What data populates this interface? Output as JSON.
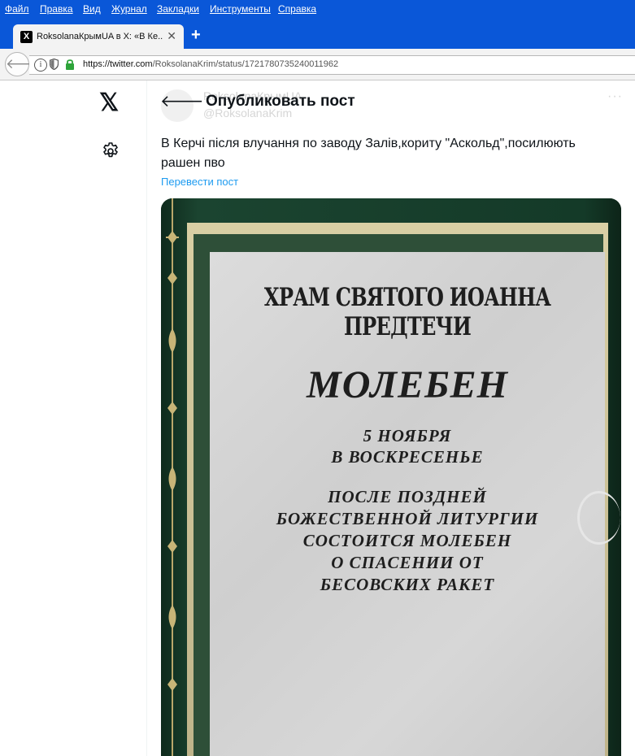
{
  "browser": {
    "menu": [
      "Файл",
      "Правка",
      "Вид",
      "Журнал",
      "Закладки",
      "Инструменты",
      "Справка"
    ],
    "tab_title": "RoksolanaКрымUA в X: «В Ке...",
    "url_prefix": "https://twitter.com",
    "url_rest": "/RoksolanaKrim/status/1721780735240011962"
  },
  "header": {
    "title": "Опубликовать пост",
    "ghost_name": "RoksolanaКрымUA",
    "ghost_handle": "@RoksolanaKrim"
  },
  "post": {
    "text": "В Керчі після влучання по заводу Залів,кориту \"Аскольд\",посилюють рашен пво",
    "translate": "Перевести пост"
  },
  "photo_sign": {
    "line1": "ХРАМ СВЯТОГО ИОАННА ПРЕДТЕЧИ",
    "line2": "МОЛЕБЕН",
    "line3": "5 НОЯБРЯ",
    "line4": "В ВОСКРЕСЕНЬЕ",
    "line5": [
      "ПОСЛЕ ПОЗДНЕЙ",
      "БОЖЕСТВЕННОЙ ЛИТУРГИИ",
      "СОСТОИТСЯ МОЛЕБЕН",
      "О СПАСЕНИИ ОТ",
      "БЕСОВСКИХ РАКЕТ"
    ]
  },
  "icons": {
    "logo": "x-logo-icon",
    "settings": "gear-icon",
    "back": "arrow-left-icon",
    "more": "more-icon"
  }
}
